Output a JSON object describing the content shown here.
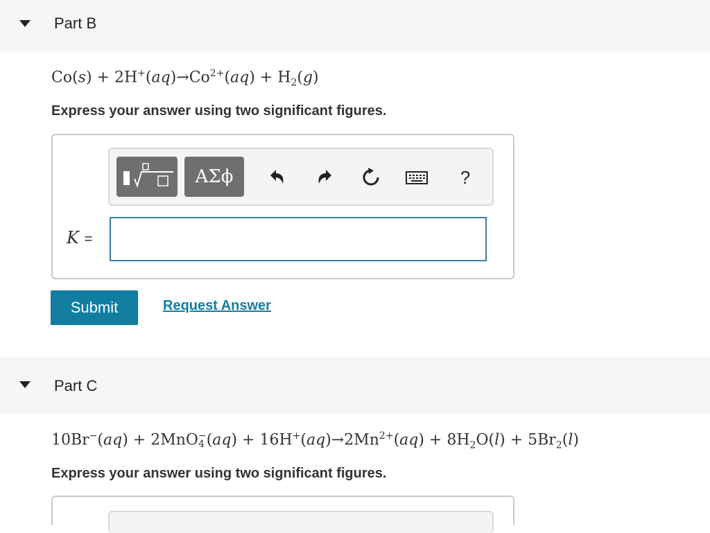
{
  "partB": {
    "title": "Part B",
    "equation": {
      "p1": "Co(",
      "s": "s",
      "p2": ") + 2H",
      "sup1": "+",
      "p3": "(",
      "aq1": "aq",
      "p4": ")→Co",
      "sup2": "2+",
      "p5": "(",
      "aq2": "aq",
      "p6": ") + H",
      "sub1": "2",
      "p7": "(",
      "g": "g",
      "p8": ")"
    },
    "instruction": "Express your answer using two significant figures.",
    "toolbar": {
      "greek_label": "ΑΣϕ",
      "help_label": "?"
    },
    "answer_label": "K",
    "equals": "=",
    "input_value": "",
    "submit_label": "Submit",
    "request_label": "Request Answer"
  },
  "partC": {
    "title": "Part C",
    "equation": {
      "p1": "10Br",
      "sup1": "−",
      "p2": "(",
      "aq1": "aq",
      "p3": ") + 2MnO",
      "sup2": "−",
      "sub1": "4",
      "p4": "(",
      "aq2": "aq",
      "p5": ") + 16H",
      "sup3": "+",
      "p6": "(",
      "aq3": "aq",
      "p7": ")→2Mn",
      "sup4": "2+",
      "p8": "(",
      "aq4": "aq",
      "p9": ") + 8H",
      "sub2": "2",
      "p10": "O(",
      "l1": "l",
      "p11": ") + 5Br",
      "sub3": "2",
      "p12": "(",
      "l2": "l",
      "p13": ")"
    },
    "instruction": "Express your answer using two significant figures."
  }
}
